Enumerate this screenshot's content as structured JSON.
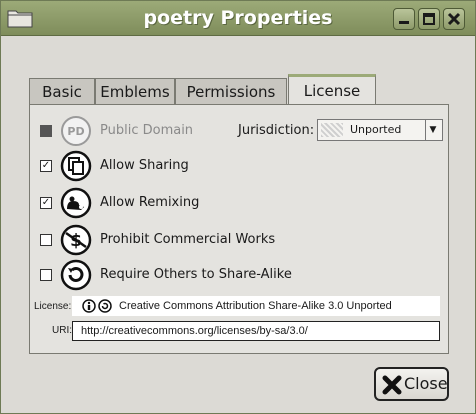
{
  "window": {
    "title": "poetry Properties"
  },
  "tabs": [
    {
      "label": "Basic"
    },
    {
      "label": "Emblems"
    },
    {
      "label": "Permissions"
    },
    {
      "label": "License",
      "active": true
    }
  ],
  "license_tab": {
    "public_domain": {
      "label": "Public Domain",
      "checked": false,
      "enabled": false,
      "icon": "public-domain-icon",
      "icon_text": "PD"
    },
    "jurisdiction": {
      "label": "Jurisdiction:",
      "value": "Unported"
    },
    "options": [
      {
        "label": "Allow Sharing",
        "checked": true,
        "icon": "share-icon"
      },
      {
        "label": "Allow Remixing",
        "checked": true,
        "icon": "remix-icon"
      },
      {
        "label": "Prohibit Commercial Works",
        "checked": false,
        "icon": "noncommercial-icon"
      },
      {
        "label": "Require Others to Share-Alike",
        "checked": false,
        "icon": "share-alike-icon"
      }
    ],
    "license": {
      "label": "License:",
      "value": "Creative Commons Attribution Share-Alike 3.0 Unported"
    },
    "uri": {
      "label": "URI:",
      "value": "http://creativecommons.org/licenses/by-sa/3.0/"
    }
  },
  "close_button": {
    "label": "Close"
  },
  "colors": {
    "titlebar": "#8c9a68",
    "tab_accent": "#9caa78"
  }
}
